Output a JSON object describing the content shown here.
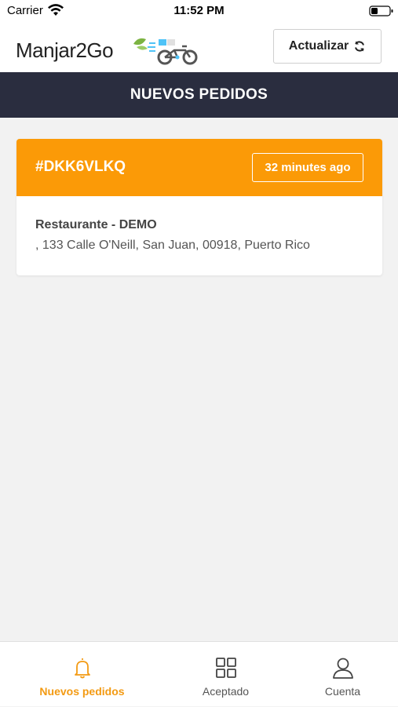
{
  "status_bar": {
    "carrier": "Carrier",
    "time": "11:52 PM"
  },
  "header": {
    "logo_text": "Manjar2Go",
    "refresh_label": "Actualizar",
    "refresh_icon": "refresh-icon"
  },
  "page_title": "NUEVOS PEDIDOS",
  "orders": [
    {
      "id": "#DKK6VLKQ",
      "time_ago": "32 minutes ago",
      "restaurant": "Restaurante - DEMO",
      "address": ", 133 Calle O'Neill, San Juan, 00918, Puerto Rico"
    }
  ],
  "bottom_nav": [
    {
      "label": "Nuevos pedidos",
      "icon": "bell-icon",
      "active": true
    },
    {
      "label": "Aceptado",
      "icon": "grid-icon",
      "active": false
    },
    {
      "label": "Cuenta",
      "icon": "user-icon",
      "active": false
    }
  ],
  "colors": {
    "accent": "#fb9a07",
    "title_bar": "#2a2d3f",
    "nav_active": "#f39a12",
    "background": "#f2f2f2"
  }
}
